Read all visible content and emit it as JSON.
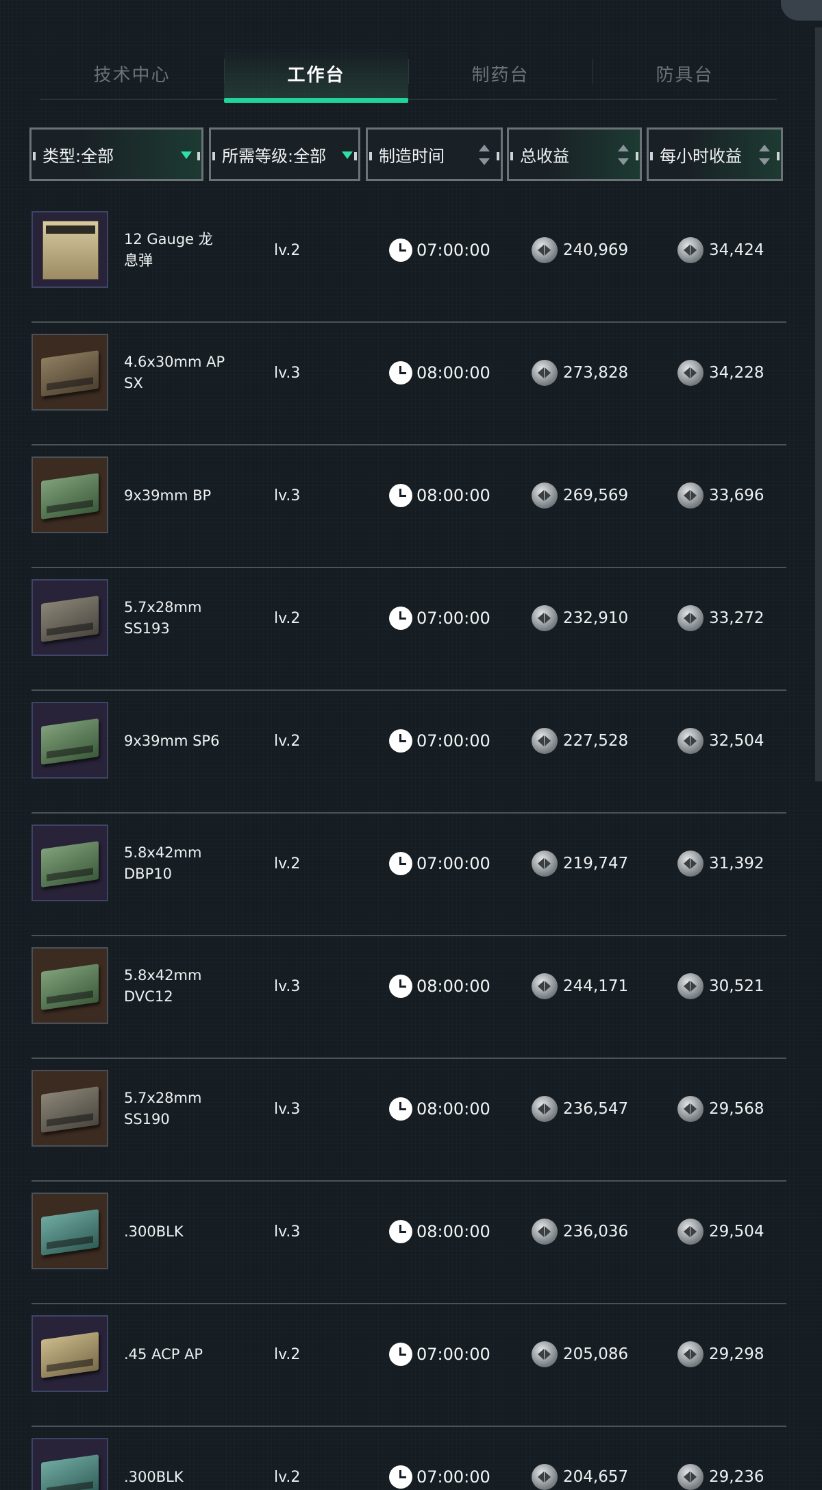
{
  "tabs": [
    {
      "label": "技术中心",
      "active": false
    },
    {
      "label": "工作台",
      "active": true
    },
    {
      "label": "制药台",
      "active": false
    },
    {
      "label": "防具台",
      "active": false
    }
  ],
  "filters": {
    "type": "类型:全部",
    "level": "所需等级:全部",
    "time": "制造时间",
    "total": "总收益",
    "hourly": "每小时收益"
  },
  "colors": {
    "accent": "#1fd39a",
    "background": "#161d22"
  },
  "items": [
    {
      "name": "12 Gauge 龙息弹",
      "level": "lv.2",
      "time": "07:00:00",
      "total": "240,969",
      "hourly": "34,424",
      "icon": "shotgun-shell-box-icon"
    },
    {
      "name": "4.6x30mm AP SX",
      "level": "lv.3",
      "time": "08:00:00",
      "total": "273,828",
      "hourly": "34,228",
      "icon": "ammo-box-icon"
    },
    {
      "name": "9x39mm BP",
      "level": "lv.3",
      "time": "08:00:00",
      "total": "269,569",
      "hourly": "33,696",
      "icon": "ammo-box-icon"
    },
    {
      "name": "5.7x28mm SS193",
      "level": "lv.2",
      "time": "07:00:00",
      "total": "232,910",
      "hourly": "33,272",
      "icon": "ammo-box-icon"
    },
    {
      "name": "9x39mm SP6",
      "level": "lv.2",
      "time": "07:00:00",
      "total": "227,528",
      "hourly": "32,504",
      "icon": "ammo-box-icon"
    },
    {
      "name": "5.8x42mm DBP10",
      "level": "lv.2",
      "time": "07:00:00",
      "total": "219,747",
      "hourly": "31,392",
      "icon": "ammo-box-icon"
    },
    {
      "name": "5.8x42mm DVC12",
      "level": "lv.3",
      "time": "08:00:00",
      "total": "244,171",
      "hourly": "30,521",
      "icon": "ammo-box-icon"
    },
    {
      "name": "5.7x28mm SS190",
      "level": "lv.3",
      "time": "08:00:00",
      "total": "236,547",
      "hourly": "29,568",
      "icon": "ammo-box-icon"
    },
    {
      "name": ".300BLK",
      "level": "lv.3",
      "time": "08:00:00",
      "total": "236,036",
      "hourly": "29,504",
      "icon": "ammo-box-icon"
    },
    {
      "name": ".45 ACP AP",
      "level": "lv.2",
      "time": "07:00:00",
      "total": "205,086",
      "hourly": "29,298",
      "icon": "ammo-box-icon"
    },
    {
      "name": ".300BLK",
      "level": "lv.2",
      "time": "07:00:00",
      "total": "204,657",
      "hourly": "29,236",
      "icon": "ammo-box-icon"
    }
  ]
}
